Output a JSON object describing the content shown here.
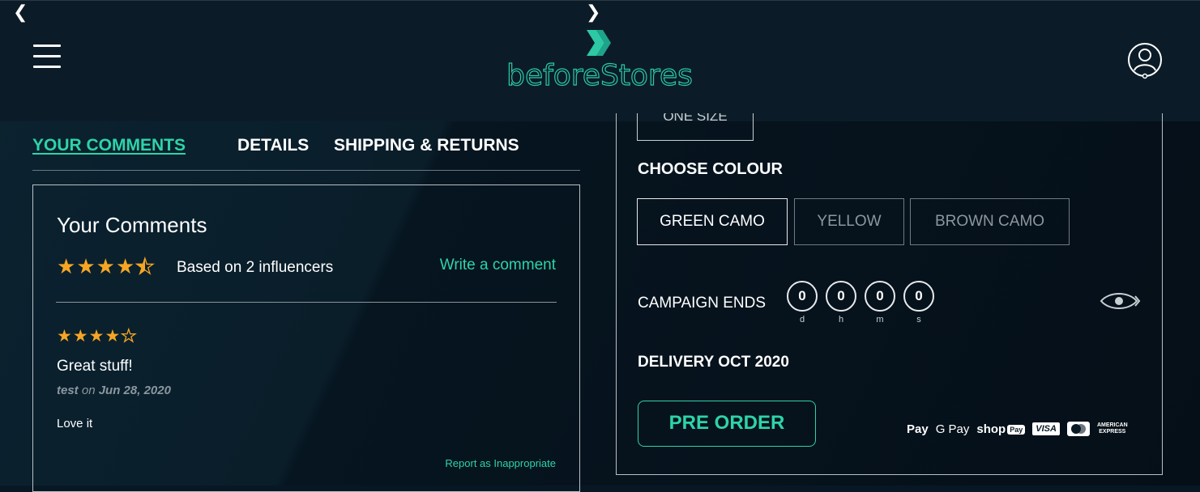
{
  "nav": {
    "prev_arrow": "❮",
    "next_arrow": "❯"
  },
  "header": {
    "logo_text": "beforeStores",
    "logo_icon": "double-chevron-right-icon",
    "menu_icon": "hamburger-menu-icon",
    "account_icon": "user-account-icon"
  },
  "tabs": [
    {
      "label": "YOUR COMMENTS",
      "active": true
    },
    {
      "label": "DETAILS",
      "active": false
    },
    {
      "label": "SHIPPING & RETURNS",
      "active": false
    }
  ],
  "comments": {
    "title": "Your Comments",
    "rating": 4.5,
    "based_on": "Based on 2 influencers",
    "write_link": "Write a comment",
    "review": {
      "rating": 4,
      "title": "Great stuff!",
      "author": "test",
      "on": "on",
      "date": "Jun 28, 2020",
      "body": "Love it",
      "report_link": "Report as Inappropriate"
    }
  },
  "product": {
    "size_option": "ONE SIZE",
    "choose_colour_label": "CHOOSE COLOUR",
    "colours": [
      {
        "label": "GREEN CAMO",
        "selected": true
      },
      {
        "label": "YELLOW",
        "selected": false
      },
      {
        "label": "BROWN CAMO",
        "selected": false
      }
    ],
    "campaign_label": "CAMPAIGN ENDS",
    "countdown": [
      {
        "value": "0",
        "unit": "d"
      },
      {
        "value": "0",
        "unit": "h"
      },
      {
        "value": "0",
        "unit": "m"
      },
      {
        "value": "0",
        "unit": "s"
      }
    ],
    "delivery": "DELIVERY OCT 2020",
    "preorder_label": "PRE ORDER",
    "payment_methods": {
      "apple": "Pay",
      "google": "G Pay",
      "shop": "shop",
      "shop_badge": "Pay",
      "visa": "VISA",
      "amex_line1": "AMERICAN",
      "amex_line2": "EXPRESS"
    }
  },
  "colors": {
    "accent": "#2ed3a8",
    "background": "#071824",
    "star": "#f5a623"
  }
}
